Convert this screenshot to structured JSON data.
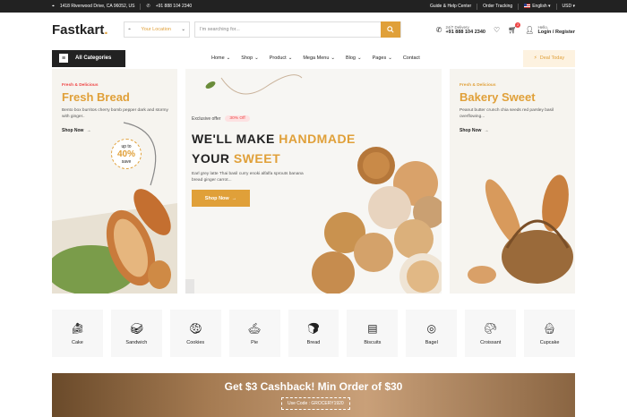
{
  "topbar": {
    "address": "1418 Riverwood Drive, CA 96052, US",
    "phone": "+91 888 104 2340",
    "help": "Guide & Help Center",
    "tracking": "Order Tracking",
    "language": "English",
    "currency": "USD"
  },
  "header": {
    "logo_a": "Fast",
    "logo_b": "kart",
    "logo_dot": ".",
    "location": "Your Location",
    "search_placeholder": "I'm searching for...",
    "delivery_label": "24/7 Delivery",
    "delivery_phone": "+91 888 104 2340",
    "cart_count": "2",
    "hello": "Hello,",
    "account": "Login / Register"
  },
  "nav": {
    "all_categories": "All Categories",
    "items": [
      "Home",
      "Shop",
      "Product",
      "Mega Menu",
      "Blog",
      "Pages",
      "Contact"
    ],
    "deal": "Deal Today"
  },
  "hero": {
    "left": {
      "kicker": "Fresh & Delicious",
      "title": "Fresh Bread",
      "desc": "Bento box burritos cherry bomb pepper dark and stormy with ginger..",
      "cta": "Shop Now",
      "badge_top": "up to",
      "badge_value": "40%",
      "badge_bottom": "save"
    },
    "center": {
      "exclusive": "Exclusive offer",
      "off": "30% Off",
      "line1_a": "WE'LL MAKE ",
      "line1_b": "HANDMADE",
      "line2_a": "YOUR ",
      "line2_b": "SWEET",
      "desc": "Earl grey latte Thai basil curry enoki alfalfa sprouts banana bread ginger carrot...",
      "cta": "Shop Now"
    },
    "right": {
      "kicker": "Fresh & Delicious",
      "title": "Bakery Sweet",
      "desc": "Peanut butter crunch chia seeds red parsley basil overflowing...",
      "cta": "Shop Now"
    }
  },
  "categories": [
    "Cake",
    "Sandwich",
    "Cookies",
    "Pie",
    "Bread",
    "Biscuits",
    "Bagel",
    "Croissant",
    "Cupcake"
  ],
  "banner": {
    "title": "Get $3 Cashback! Min Order of $30",
    "code": "Use Code : GROCERY1920"
  },
  "colors": {
    "accent": "#e0a039",
    "red": "#ef4444",
    "dark": "#222222"
  }
}
